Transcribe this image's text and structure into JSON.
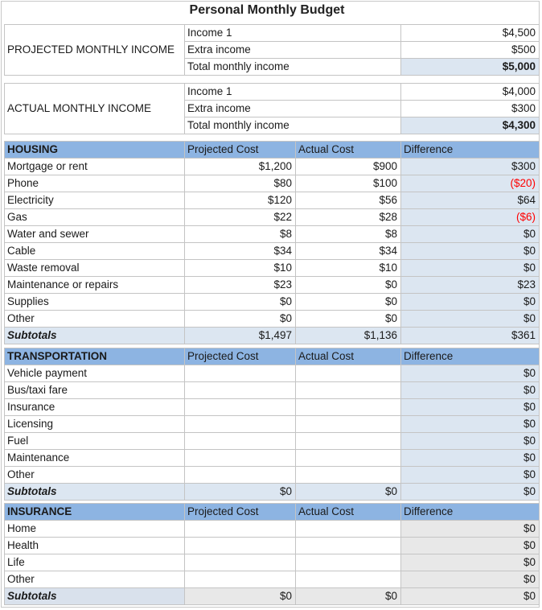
{
  "title": "Personal Monthly Budget",
  "projected_income": {
    "label": "PROJECTED MONTHLY INCOME",
    "rows": [
      {
        "name": "Income 1",
        "value": "$4,500"
      },
      {
        "name": "Extra income",
        "value": "$500"
      },
      {
        "name": "Total monthly income",
        "value": "$5,000"
      }
    ]
  },
  "actual_income": {
    "label": "ACTUAL MONTHLY INCOME",
    "rows": [
      {
        "name": "Income 1",
        "value": "$4,000"
      },
      {
        "name": "Extra income",
        "value": "$300"
      },
      {
        "name": "Total monthly income",
        "value": "$4,300"
      }
    ]
  },
  "columns": {
    "projected": "Projected Cost",
    "actual": "Actual Cost",
    "difference": "Difference"
  },
  "colors": {
    "header_blue": "#8db4e2",
    "light_blue": "#dce6f1",
    "grey": "#e8e8e8",
    "negative_red": "#ff0000"
  },
  "housing": {
    "title": "HOUSING",
    "rows": [
      {
        "name": "Mortgage or rent",
        "projected": "$1,200",
        "actual": "$900",
        "difference": "$300",
        "negative": false
      },
      {
        "name": "Phone",
        "projected": "$80",
        "actual": "$100",
        "difference": "($20)",
        "negative": true
      },
      {
        "name": "Electricity",
        "projected": "$120",
        "actual": "$56",
        "difference": "$64",
        "negative": false
      },
      {
        "name": "Gas",
        "projected": "$22",
        "actual": "$28",
        "difference": "($6)",
        "negative": true
      },
      {
        "name": "Water and sewer",
        "projected": "$8",
        "actual": "$8",
        "difference": "$0",
        "negative": false
      },
      {
        "name": "Cable",
        "projected": "$34",
        "actual": "$34",
        "difference": "$0",
        "negative": false
      },
      {
        "name": "Waste removal",
        "projected": "$10",
        "actual": "$10",
        "difference": "$0",
        "negative": false
      },
      {
        "name": "Maintenance or repairs",
        "projected": "$23",
        "actual": "$0",
        "difference": "$23",
        "negative": false
      },
      {
        "name": "Supplies",
        "projected": "$0",
        "actual": "$0",
        "difference": "$0",
        "negative": false
      },
      {
        "name": "Other",
        "projected": "$0",
        "actual": "$0",
        "difference": "$0",
        "negative": false
      }
    ],
    "subtotal": {
      "label": "Subtotals",
      "projected": "$1,497",
      "actual": "$1,136",
      "difference": "$361"
    }
  },
  "transportation": {
    "title": "TRANSPORTATION",
    "rows": [
      {
        "name": "Vehicle payment",
        "projected": "",
        "actual": "",
        "difference": "$0"
      },
      {
        "name": "Bus/taxi fare",
        "projected": "",
        "actual": "",
        "difference": "$0"
      },
      {
        "name": "Insurance",
        "projected": "",
        "actual": "",
        "difference": "$0"
      },
      {
        "name": "Licensing",
        "projected": "",
        "actual": "",
        "difference": "$0"
      },
      {
        "name": "Fuel",
        "projected": "",
        "actual": "",
        "difference": "$0"
      },
      {
        "name": "Maintenance",
        "projected": "",
        "actual": "",
        "difference": "$0"
      },
      {
        "name": "Other",
        "projected": "",
        "actual": "",
        "difference": "$0"
      }
    ],
    "subtotal": {
      "label": "Subtotals",
      "projected": "$0",
      "actual": "$0",
      "difference": "$0"
    }
  },
  "insurance": {
    "title": "INSURANCE",
    "rows": [
      {
        "name": "Home",
        "projected": "",
        "actual": "",
        "difference": "$0"
      },
      {
        "name": "Health",
        "projected": "",
        "actual": "",
        "difference": "$0"
      },
      {
        "name": "Life",
        "projected": "",
        "actual": "",
        "difference": "$0"
      },
      {
        "name": "Other",
        "projected": "",
        "actual": "",
        "difference": "$0"
      }
    ],
    "subtotal": {
      "label": "Subtotals",
      "projected": "$0",
      "actual": "$0",
      "difference": "$0"
    }
  }
}
